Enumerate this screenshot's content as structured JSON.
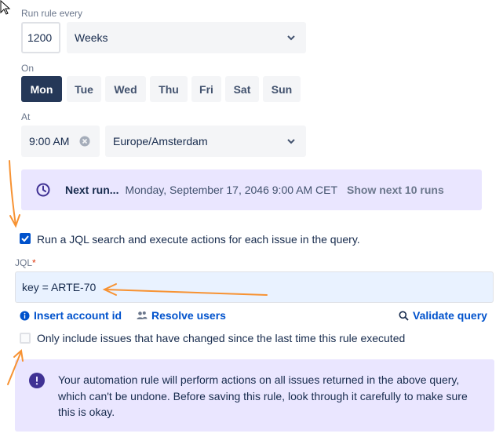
{
  "schedule": {
    "run_every_label": "Run rule every",
    "interval_value": "1200",
    "interval_unit": "Weeks",
    "on_label": "On",
    "days": [
      "Mon",
      "Tue",
      "Wed",
      "Thu",
      "Fri",
      "Sat",
      "Sun"
    ],
    "selected_day": "Mon",
    "at_label": "At",
    "time_value": "9:00 AM",
    "timezone": "Europe/Amsterdam"
  },
  "next_run": {
    "label": "Next run...",
    "datetime": "Monday, September 17, 2046 9:00 AM CET",
    "show_next_link": "Show next 10 runs"
  },
  "jql_section": {
    "run_jql_checkbox_label": "Run a JQL search and execute actions for each issue in the query.",
    "run_jql_checked": true,
    "jql_label": "JQL",
    "required_marker": "*",
    "jql_value": "key = ARTE-70",
    "insert_account_id_link": "Insert account id",
    "resolve_users_link": "Resolve users",
    "validate_query_link": "Validate query",
    "only_changed_label": "Only include issues that have changed since the last time this rule executed",
    "only_changed_checked": false
  },
  "warning": {
    "line1": "Your automation rule will perform actions on all issues returned in the above query,",
    "line2": "which can't be undone. Before saving this rule, look through it carefully to make sure",
    "line3": "this is okay."
  },
  "colors": {
    "brand_blue": "#0052CC",
    "selected_day_bg": "#253858",
    "purple_banner": "#EAE6FF",
    "annotation_arrow": "#F79232"
  }
}
